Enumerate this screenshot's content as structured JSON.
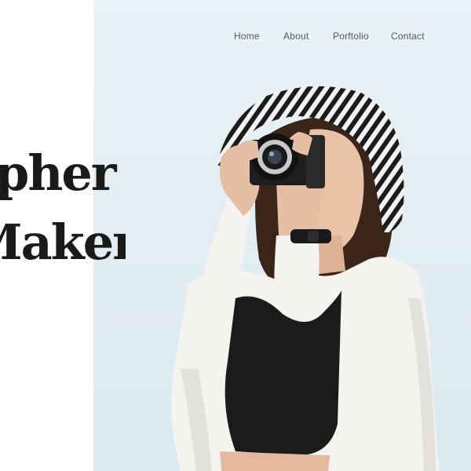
{
  "nav": {
    "items": [
      {
        "label": "Home"
      },
      {
        "label": "About"
      },
      {
        "label": "Porftolio"
      },
      {
        "label": "Contact"
      }
    ]
  },
  "hero": {
    "headline_line1": "pher",
    "headline_line2": "Maker"
  },
  "colors": {
    "hero_background": "#e2eef4",
    "headline": "#1a1a1a",
    "nav_text": "#55575a"
  }
}
